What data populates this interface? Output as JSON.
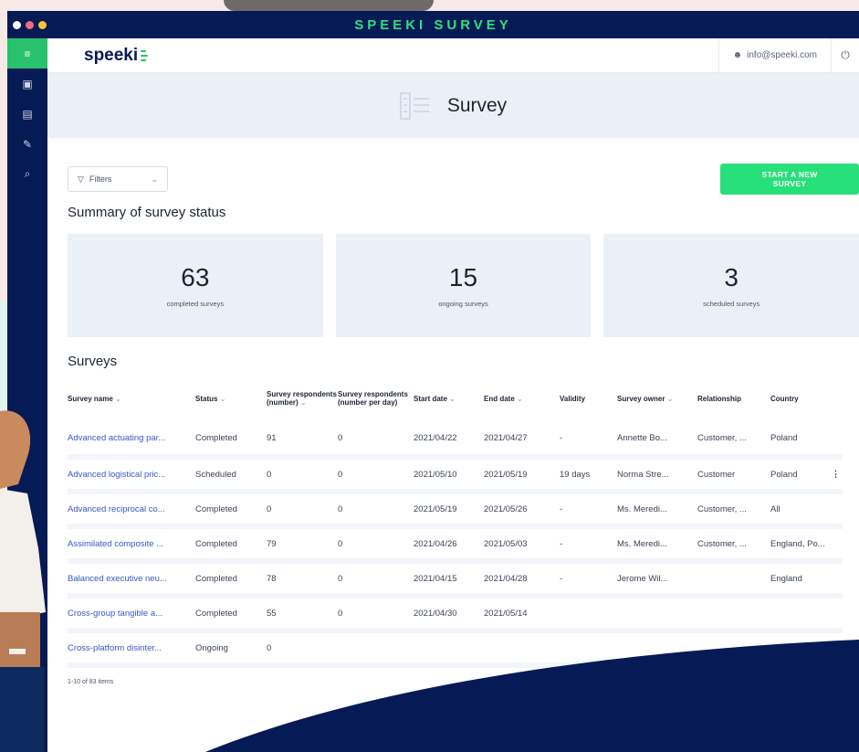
{
  "window": {
    "title": "SPEEKI SURVEY",
    "dot_colors": [
      "#ffffff",
      "#f46b7a",
      "#f8c23a"
    ]
  },
  "rail": {
    "items": [
      {
        "icon": "menu-icon",
        "glyph": "≡"
      },
      {
        "icon": "dashboard-icon",
        "glyph": "▣"
      },
      {
        "icon": "document-icon",
        "glyph": "▤"
      },
      {
        "icon": "edit-icon",
        "glyph": "✎"
      },
      {
        "icon": "search-icon",
        "glyph": "⌕"
      }
    ]
  },
  "appbar": {
    "logo": "speeki",
    "email": "info@speeki.com"
  },
  "hero": {
    "title": "Survey"
  },
  "toolbar": {
    "filters_label": "Filters",
    "cta_label": "START A NEW SURVEY"
  },
  "summary": {
    "title": "Summary of survey status",
    "cards": [
      {
        "value": "63",
        "label": "completed surveys"
      },
      {
        "value": "15",
        "label": "ongoing surveys"
      },
      {
        "value": "3",
        "label": "scheduled surveys"
      }
    ]
  },
  "surveys": {
    "title": "Surveys",
    "columns": [
      "Survey name",
      "Status",
      "Survey respondents (number)",
      "Survey respondents (number per day)",
      "Start date",
      "End date",
      "Validity",
      "Survey owner",
      "Relationship",
      "Country"
    ],
    "rows": [
      [
        "Advanced actuating par...",
        "Completed",
        "91",
        "0",
        "2021/04/22",
        "2021/04/27",
        "-",
        "Annette Bo...",
        "Customer, ...",
        "Poland"
      ],
      [
        "Advanced logistical pric...",
        "Scheduled",
        "0",
        "0",
        "2021/05/10",
        "2021/05/19",
        "19 days",
        "Norma Stre...",
        "Customer",
        "Poland"
      ],
      [
        "Advanced reciprocal co...",
        "Completed",
        "0",
        "0",
        "2021/05/19",
        "2021/05/26",
        "-",
        "Ms. Meredi...",
        "Customer, ...",
        "All"
      ],
      [
        "Assimilated composite ...",
        "Completed",
        "79",
        "0",
        "2021/04/26",
        "2021/05/03",
        "-",
        "Ms. Meredi...",
        "Customer, ...",
        "England, Po..."
      ],
      [
        "Balanced executive neu...",
        "Completed",
        "78",
        "0",
        "2021/04/15",
        "2021/04/28",
        "-",
        "Jerome Wil...",
        "",
        "England"
      ],
      [
        "Cross-group tangible a...",
        "Completed",
        "55",
        "0",
        "2021/04/30",
        "2021/05/14",
        "",
        "",
        "",
        ""
      ],
      [
        "Cross-platform disinter...",
        "Ongoing",
        "0",
        "",
        "",
        "",
        "",
        "",
        "",
        ""
      ]
    ],
    "pager": "1-10 of 83 items"
  }
}
